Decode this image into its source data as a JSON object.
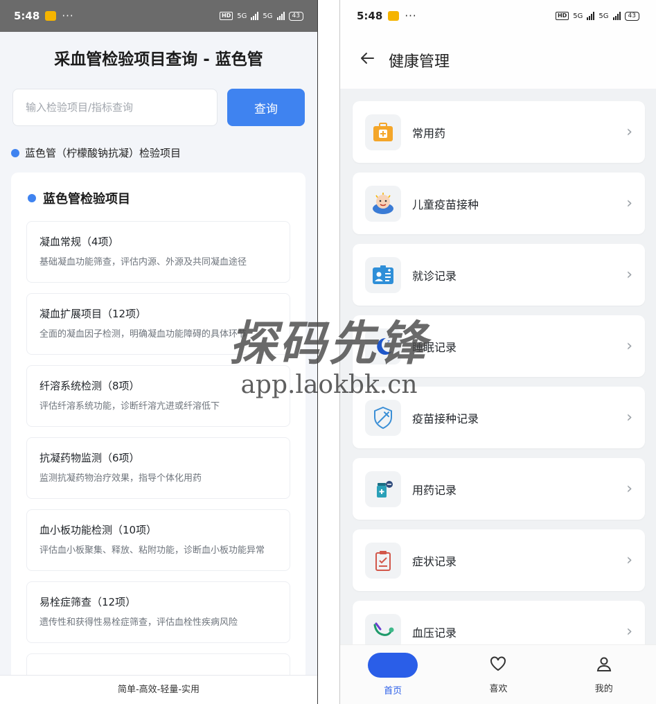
{
  "left": {
    "status": {
      "time": "5:48",
      "dots": "···",
      "network": "5G",
      "battery": "43"
    },
    "title": "采血管检验项目查询 - 蓝色管",
    "search": {
      "placeholder": "输入检验项目/指标查询",
      "button": "查询"
    },
    "section_label": "蓝色管（柠檬酸钠抗凝）检验项目",
    "card_title": "蓝色管检验项目",
    "items": [
      {
        "title": "凝血常规（4项）",
        "desc": "基础凝血功能筛查，评估内源、外源及共同凝血途径"
      },
      {
        "title": "凝血扩展项目（12项）",
        "desc": "全面的凝血因子检测，明确凝血功能障碍的具体环节"
      },
      {
        "title": "纤溶系统检测（8项）",
        "desc": "评估纤溶系统功能，诊断纤溶亢进或纤溶低下"
      },
      {
        "title": "抗凝药物监测（6项）",
        "desc": "监测抗凝药物治疗效果，指导个体化用药"
      },
      {
        "title": "血小板功能检测（10项）",
        "desc": "评估血小板聚集、释放、粘附功能，诊断血小板功能异常"
      },
      {
        "title": "易栓症筛查（12项）",
        "desc": "遗传性和获得性易栓症筛查，评估血栓性疾病风险"
      }
    ],
    "footer": "简单-高效-轻量-实用",
    "accent": "#3f83f0"
  },
  "right": {
    "status": {
      "time": "5:48",
      "dots": "···",
      "network": "5G",
      "battery": "43"
    },
    "title": "健康管理",
    "rows": [
      {
        "label": "常用药",
        "icon": "medicine-box-icon"
      },
      {
        "label": "儿童疫苗接种",
        "icon": "baby-icon"
      },
      {
        "label": "就诊记录",
        "icon": "medical-card-icon"
      },
      {
        "label": "睡眠记录",
        "icon": "moon-icon"
      },
      {
        "label": "疫苗接种记录",
        "icon": "syringe-shield-icon"
      },
      {
        "label": "用药记录",
        "icon": "pill-bottle-icon"
      },
      {
        "label": "症状记录",
        "icon": "clipboard-check-icon"
      },
      {
        "label": "血压记录",
        "icon": "stethoscope-icon"
      }
    ],
    "tabs": [
      {
        "label": "首页",
        "icon": "home-pill-icon"
      },
      {
        "label": "喜欢",
        "icon": "heart-icon"
      },
      {
        "label": "我的",
        "icon": "person-icon"
      }
    ],
    "accent": "#2a5ee8"
  },
  "watermark": {
    "top": "探码先锋",
    "bottom": "app.laokbk.cn"
  }
}
